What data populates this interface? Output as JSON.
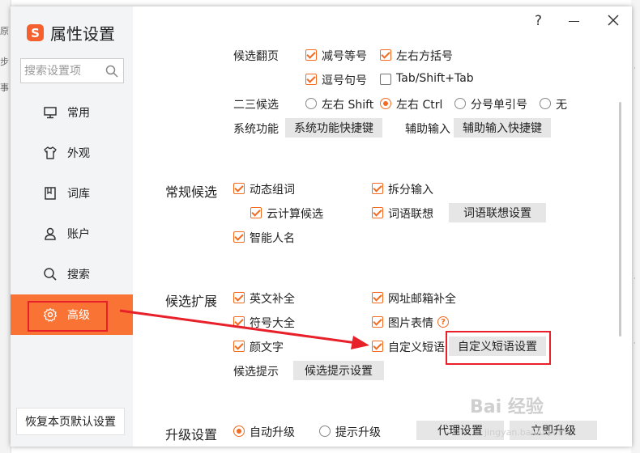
{
  "background": {
    "left_texts": [
      "原",
      "步",
      "事"
    ]
  },
  "app": {
    "title": "属性设置",
    "logo_letter": "S"
  },
  "search": {
    "placeholder": "搜索设置项"
  },
  "nav": [
    {
      "label": "常用",
      "icon": "monitor-icon"
    },
    {
      "label": "外观",
      "icon": "tshirt-icon"
    },
    {
      "label": "词库",
      "icon": "book-icon"
    },
    {
      "label": "账户",
      "icon": "user-icon"
    },
    {
      "label": "搜索",
      "icon": "search-icon"
    },
    {
      "label": "高级",
      "icon": "gear-icon",
      "active": true
    }
  ],
  "restore_button": "恢复本页默认设置",
  "window_controls": {
    "help": "?"
  },
  "page_turn": {
    "label": "候选翻页",
    "options": [
      {
        "label": "减号等号",
        "checked": true
      },
      {
        "label": "左右方括号",
        "checked": true
      },
      {
        "label": "逗号句号",
        "checked": true
      },
      {
        "label": "Tab/Shift+Tab",
        "checked": false
      }
    ]
  },
  "second_third": {
    "label": "二三候选",
    "options": [
      {
        "label": "左右 Shift",
        "selected": false
      },
      {
        "label": "左右 Ctrl",
        "selected": true
      },
      {
        "label": "分号单引号",
        "selected": false
      },
      {
        "label": "无",
        "selected": false
      }
    ]
  },
  "system": {
    "label": "系统功能",
    "button": "系统功能快捷键",
    "aux_label": "辅助输入",
    "aux_button": "辅助输入快捷键"
  },
  "regular": {
    "title": "常规候选",
    "items": {
      "dynamic": {
        "label": "动态组词",
        "checked": true
      },
      "split": {
        "label": "拆分输入",
        "checked": true
      },
      "cloud": {
        "label": "云计算候选",
        "checked": true
      },
      "assoc": {
        "label": "词语联想",
        "checked": true
      },
      "smart_name": {
        "label": "智能人名",
        "checked": true
      }
    },
    "assoc_button": "词语联想设置"
  },
  "extend": {
    "title": "候选扩展",
    "items": {
      "english": {
        "label": "英文补全",
        "checked": true
      },
      "web_email": {
        "label": "网址邮箱补全",
        "checked": true
      },
      "symbol": {
        "label": "符号大全",
        "checked": true
      },
      "sticker": {
        "label": "图片表情",
        "checked": true
      },
      "kaomoji": {
        "label": "颜文字",
        "checked": true
      },
      "phrase": {
        "label": "自定义短语",
        "checked": true
      }
    },
    "phrase_button": "自定义短语设置",
    "hint_label": "候选提示",
    "hint_button": "候选提示设置"
  },
  "upgrade": {
    "title": "升级设置",
    "options": [
      {
        "label": "自动升级",
        "selected": true
      },
      {
        "label": "提示升级",
        "selected": false
      }
    ],
    "proxy_button": "代理设置",
    "now_button": "立即升级"
  },
  "watermark": {
    "text": "Bai 经验",
    "sub": "jingyan.baidu.com"
  },
  "colors": {
    "accent": "#f97434",
    "annotation": "#e8202a",
    "sidebar_bg": "#f3f4f6"
  }
}
